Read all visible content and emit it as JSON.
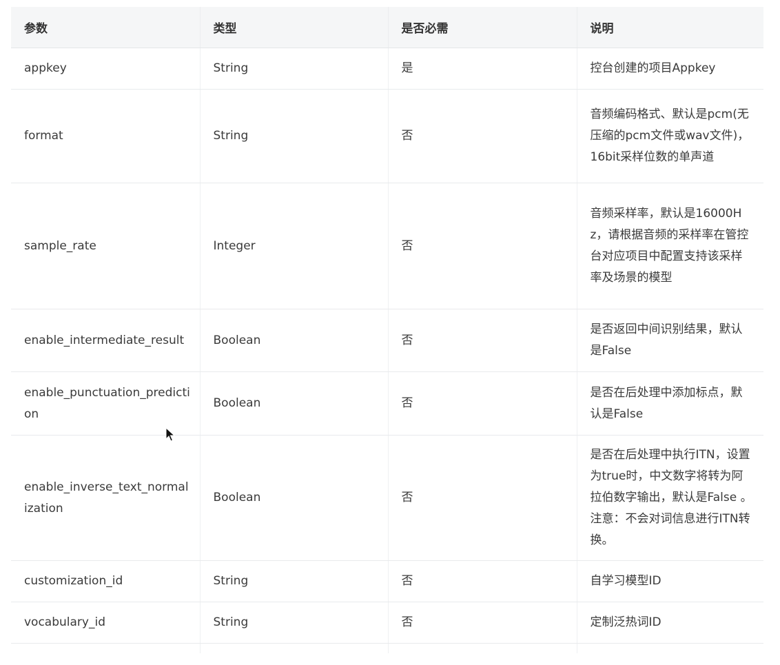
{
  "table": {
    "headers": [
      "参数",
      "类型",
      "是否必需",
      "说明"
    ],
    "rows": [
      {
        "param": "appkey",
        "type": "String",
        "required": "是",
        "desc": "控台创建的项目Appkey"
      },
      {
        "param": "format",
        "type": "String",
        "required": "否",
        "desc": "音频编码格式、默认是pcm(无压缩的pcm文件或wav文件)，16bit采样位数的单声道"
      },
      {
        "param": "sample_rate",
        "type": "Integer",
        "required": "否",
        "desc": "音频采样率，默认是16000Hz，请根据音频的采样率在管控台对应项目中配置支持该采样率及场景的模型"
      },
      {
        "param": "enable_intermediate_result",
        "type": "Boolean",
        "required": "否",
        "desc": "是否返回中间识别结果，默认是False"
      },
      {
        "param": "enable_punctuation_prediction",
        "type": "Boolean",
        "required": "否",
        "desc": "是否在后处理中添加标点，默认是False"
      },
      {
        "param": "enable_inverse_text_normalization",
        "type": "Boolean",
        "required": "否",
        "desc": "是否在后处理中执行ITN，设置为true时，中文数字将转为阿拉伯数字输出，默认是False 。注意：不会对词信息进行ITN转换。"
      },
      {
        "param": "customization_id",
        "type": "String",
        "required": "否",
        "desc": "自学习模型ID"
      },
      {
        "param": "vocabulary_id",
        "type": "String",
        "required": "否",
        "desc": "定制泛热词ID"
      }
    ]
  }
}
